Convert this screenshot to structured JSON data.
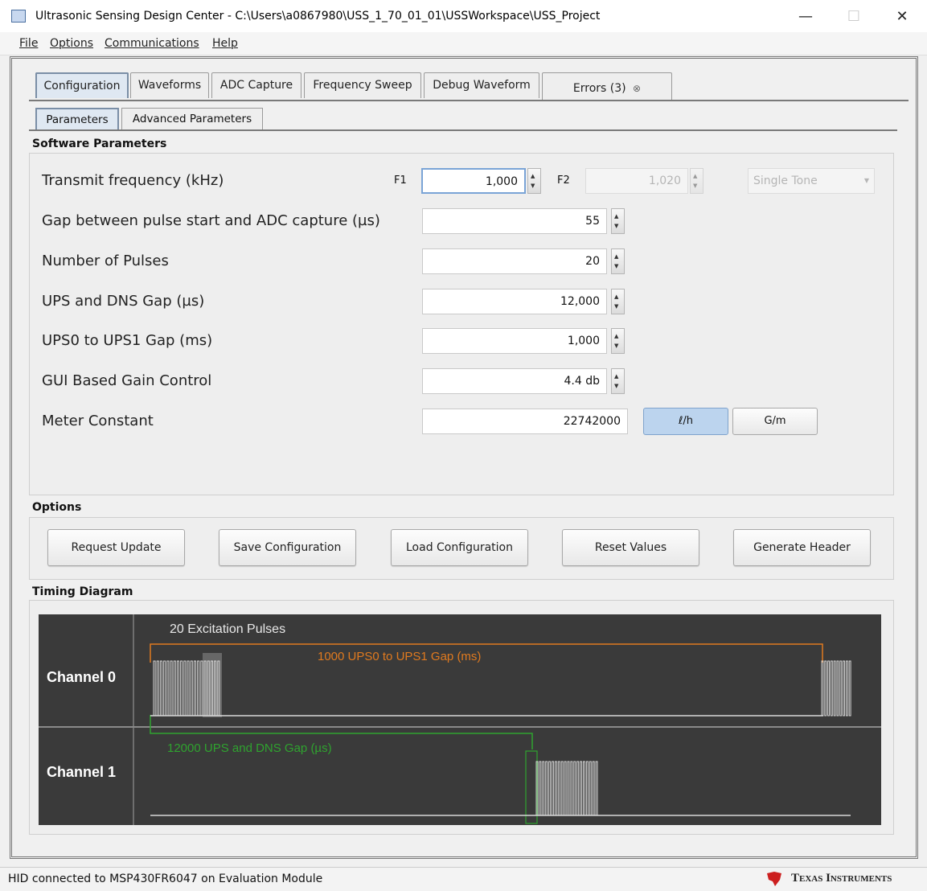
{
  "window": {
    "title": "Ultrasonic Sensing Design Center - C:\\Users\\a0867980\\USS_1_70_01_01\\USSWorkspace\\USS_Project",
    "minimize": "—",
    "maximize": "☐",
    "close": "✕"
  },
  "menu": [
    "File",
    "Options",
    "Communications",
    "Help"
  ],
  "tabs": [
    "Configuration",
    "Waveforms",
    "ADC Capture",
    "Frequency Sweep",
    "Debug Waveform",
    "Errors (3)"
  ],
  "errors_close_icon": "⊗",
  "subtabs": [
    "Parameters",
    "Advanced Parameters"
  ],
  "software_parameters": {
    "title": "Software Parameters",
    "rows": [
      {
        "label": "Transmit frequency (kHz)",
        "value": "1,000"
      },
      {
        "label": "Gap between pulse start and ADC capture (µs)",
        "value": "55"
      },
      {
        "label": "Number of Pulses",
        "value": "20"
      },
      {
        "label": "UPS and DNS Gap (µs)",
        "value": "12,000"
      },
      {
        "label": "UPS0 to UPS1 Gap (ms)",
        "value": "1,000"
      },
      {
        "label": "GUI Based Gain Control",
        "value": "4.4 db"
      },
      {
        "label": "Meter Constant",
        "value": "22742000"
      }
    ],
    "f1_label": "F1",
    "f2_label": "F2",
    "f2_value": "1,020",
    "tone_select": "Single Tone",
    "unit_buttons": [
      "ℓ/h",
      "G/m"
    ],
    "spin_up": "▲",
    "spin_down": "▼"
  },
  "options": {
    "title": "Options",
    "buttons": [
      "Request Update",
      "Save Configuration",
      "Load Configuration",
      "Reset Values",
      "Generate Header"
    ]
  },
  "timing": {
    "title": "Timing Diagram",
    "channel0": "Channel 0",
    "channel1": "Channel 1",
    "pulses_label": "20 Excitation Pulses",
    "ups_gap_label": "1000 UPS0 to UPS1 Gap (ms)",
    "dns_gap_label": "12000 UPS and DNS Gap (µs)",
    "colors": {
      "background": "#3a3a3a",
      "orange": "#e07a1f",
      "green": "#2fa32f",
      "pulse": "#d8d8d8"
    }
  },
  "status": {
    "text": "HID connected to MSP430FR6047 on Evaluation Module",
    "brand": "Texas Instruments"
  }
}
